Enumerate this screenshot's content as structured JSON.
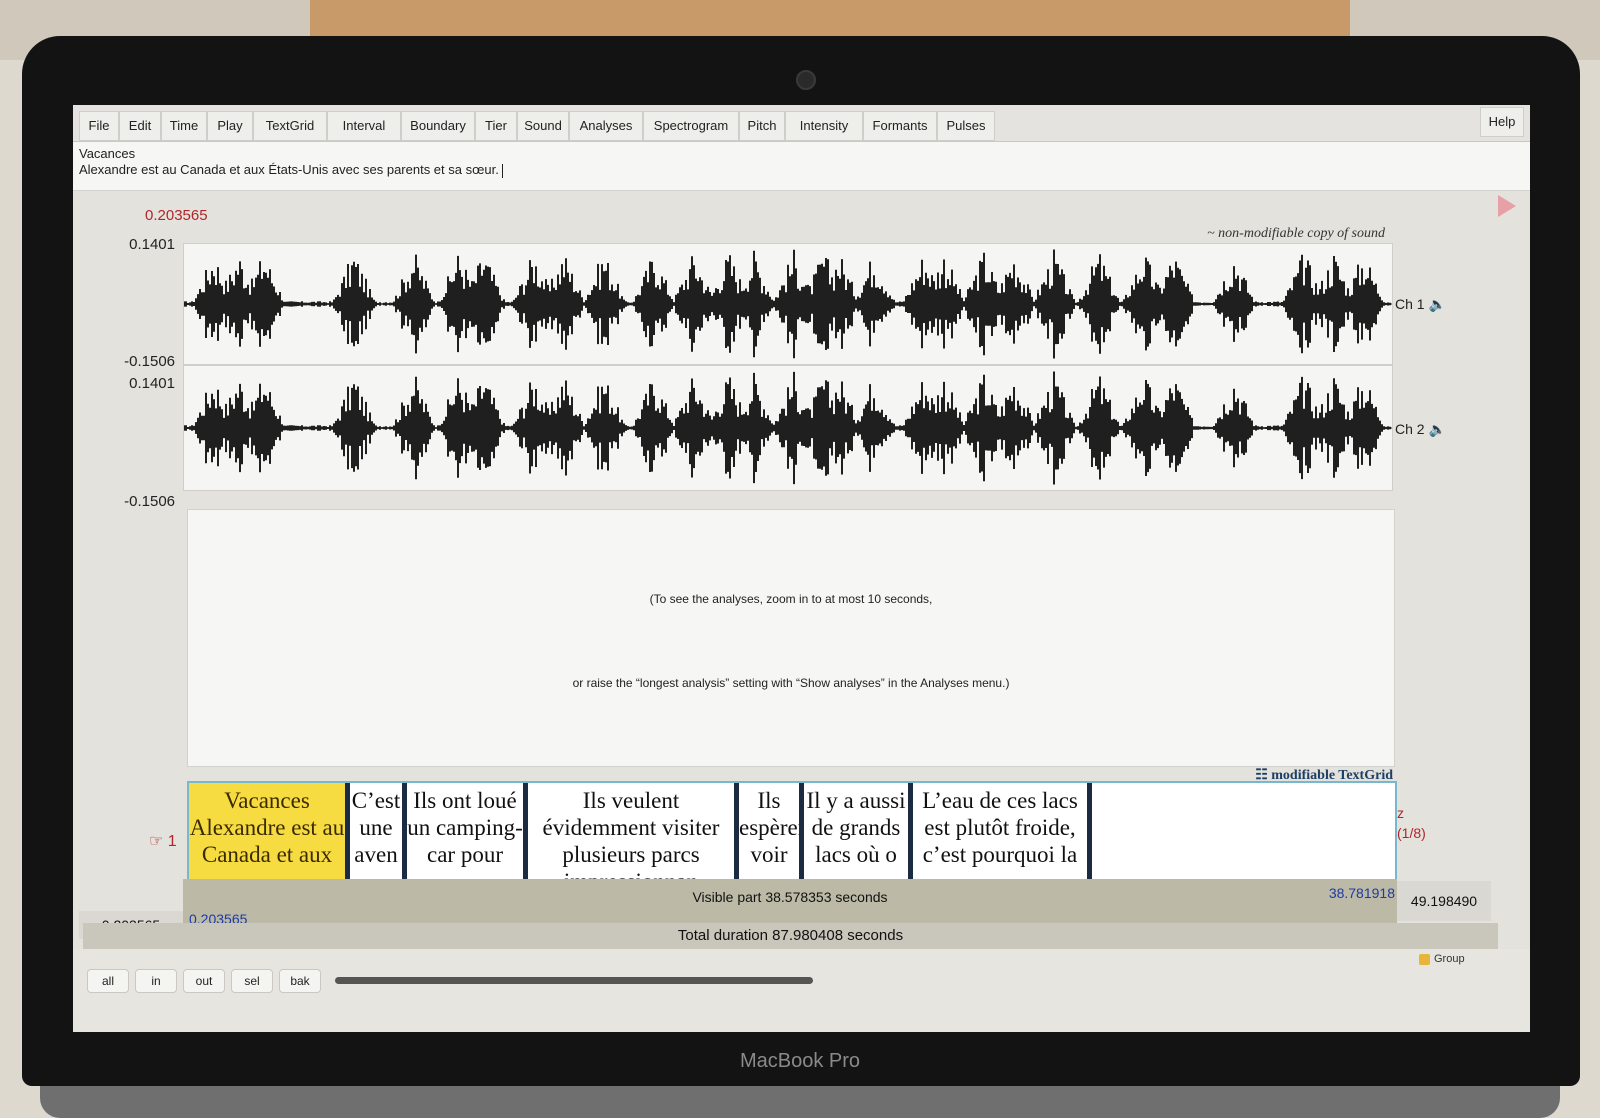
{
  "menu": [
    "File",
    "Edit",
    "Time",
    "Play",
    "TextGrid",
    "Interval",
    "Boundary",
    "Tier",
    "Sound",
    "Analyses",
    "Spectrogram",
    "Pitch",
    "Intensity",
    "Formants",
    "Pulses"
  ],
  "help_label": "Help",
  "text": {
    "title": "Vacances",
    "body": "Alexandre est au Canada et aux États-Unis avec ses parents et sa sœur."
  },
  "editor": {
    "cursor_time": "0.203565",
    "sound_note": "~ non-modifiable copy of sound",
    "ch1": {
      "label": "Ch 1",
      "max": "0.1401",
      "min": "-0.1506"
    },
    "ch2": {
      "label": "Ch 2",
      "max": "0.1401",
      "min": "-0.1506"
    },
    "analysis_msg1": "(To see the analyses, zoom in to at most 10 seconds,",
    "analysis_msg2": "or raise the “longest analysis” setting with “Show analyses” in the Analyses menu.)",
    "textgrid_label": "modifiable TextGrid",
    "tier_number": "1",
    "tier_name": "z",
    "tier_count": "(1/8)",
    "intervals": [
      "Vacances  Alexandre est au Canada et aux",
      "C’est une aven",
      "Ils ont loué un camping-car pour",
      "Ils veulent évidemment visiter plusieurs parcs impressionnan",
      "Ils espèrent voir",
      "Il y a aussi de grands lacs où o",
      "L’eau de ces lacs est plutôt froide, c’est pourquoi la",
      ""
    ],
    "visible_part": "Visible part 38.578353 seconds",
    "window_start": "0.203565",
    "window_end": "38.781918",
    "left_time": "0.203565",
    "right_time": "49.198490",
    "total_duration": "Total duration 87.980408 seconds"
  },
  "zoom_buttons": [
    "all",
    "in",
    "out",
    "sel",
    "bak"
  ],
  "group_label": "Group",
  "brand": "MacBook Pro"
}
